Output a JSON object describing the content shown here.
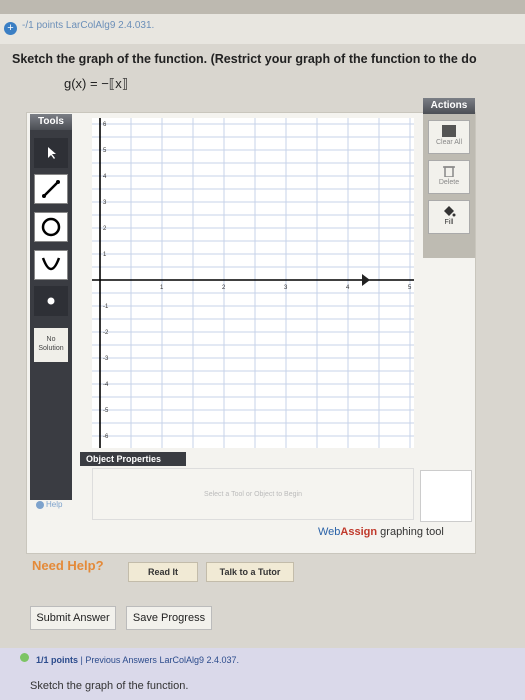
{
  "header": {
    "points": "-/1 points  LarColAlg9 2.4.031."
  },
  "question": {
    "prompt": "Sketch the graph of the function. (Restrict your graph of the function to the do",
    "function": "g(x) = −⟦x⟧"
  },
  "tools": {
    "title": "Tools",
    "no_solution": "No Solution"
  },
  "grid": {
    "x_ticks": [
      "1",
      "2",
      "3",
      "4",
      "5"
    ],
    "y_ticks": [
      "6",
      "5",
      "4",
      "3",
      "2",
      "1",
      "-1",
      "-2",
      "-3",
      "-4",
      "-5",
      "-6"
    ]
  },
  "actions": {
    "title": "Actions",
    "clear_all": "Clear All",
    "delete": "Delete",
    "fill": "Fill"
  },
  "object_properties": {
    "title": "Object Properties",
    "hint": "Select a Tool or Object to Begin"
  },
  "help_link": "Help",
  "brand": {
    "web": "Web",
    "assign": "Assign",
    "tail": " graphing tool"
  },
  "need_help": {
    "label": "Need Help?",
    "read_it": "Read It",
    "talk_to_tutor": "Talk to a Tutor"
  },
  "submit_label": "Submit Answer",
  "save_label": "Save Progress",
  "next_question": {
    "points": "1/1 points",
    "separator": "|",
    "previous_answers": "Previous Answers",
    "code": "LarColAlg9 2.4.037.",
    "prompt": "Sketch the graph of the function."
  },
  "colors": {
    "accent_orange": "#e48a39",
    "webassign_blue": "#2a62a8",
    "webassign_red": "#c0392b",
    "toolbar_dark": "#3a3c42"
  }
}
